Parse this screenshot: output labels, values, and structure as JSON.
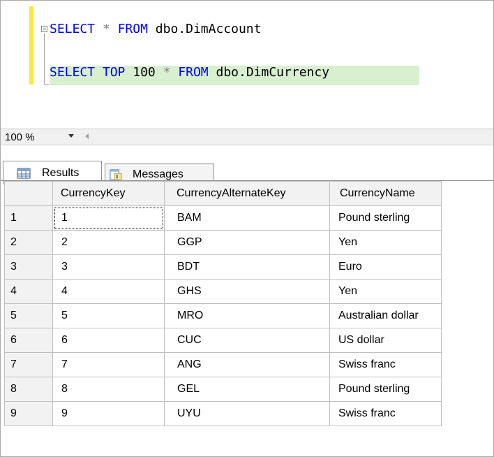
{
  "editor": {
    "line1": {
      "kw1": "SELECT",
      "op": "*",
      "kw2": "FROM",
      "obj": "dbo.DimAccount"
    },
    "line2": {
      "kw1": "SELECT",
      "kw2": "TOP",
      "num": "100",
      "op": "*",
      "kw3": "FROM",
      "obj": "dbo.DimCurrency"
    }
  },
  "zoom": {
    "value": "100 %"
  },
  "tabs": [
    {
      "label": "Results",
      "icon": "grid-icon",
      "active": true
    },
    {
      "label": "Messages",
      "icon": "messages-icon",
      "active": false
    }
  ],
  "grid": {
    "columns": [
      "",
      "CurrencyKey",
      "CurrencyAlternateKey",
      "CurrencyName"
    ],
    "rows": [
      {
        "n": "1",
        "key": "1",
        "alt": "BAM",
        "name": "Pound sterling"
      },
      {
        "n": "2",
        "key": "2",
        "alt": "GGP",
        "name": "Yen"
      },
      {
        "n": "3",
        "key": "3",
        "alt": "BDT",
        "name": "Euro"
      },
      {
        "n": "4",
        "key": "4",
        "alt": "GHS",
        "name": "Yen"
      },
      {
        "n": "5",
        "key": "5",
        "alt": "MRO",
        "name": "Australian dollar"
      },
      {
        "n": "6",
        "key": "6",
        "alt": "CUC",
        "name": "US dollar"
      },
      {
        "n": "7",
        "key": "7",
        "alt": "ANG",
        "name": "Swiss franc"
      },
      {
        "n": "8",
        "key": "8",
        "alt": "GEL",
        "name": "Pound sterling"
      },
      {
        "n": "9",
        "key": "9",
        "alt": "UYU",
        "name": "Swiss franc"
      }
    ]
  },
  "colors": {
    "keyword": "#0000ff",
    "operator": "#808080",
    "selection": "#d8efd0",
    "change_bar": "#ffe83c"
  }
}
